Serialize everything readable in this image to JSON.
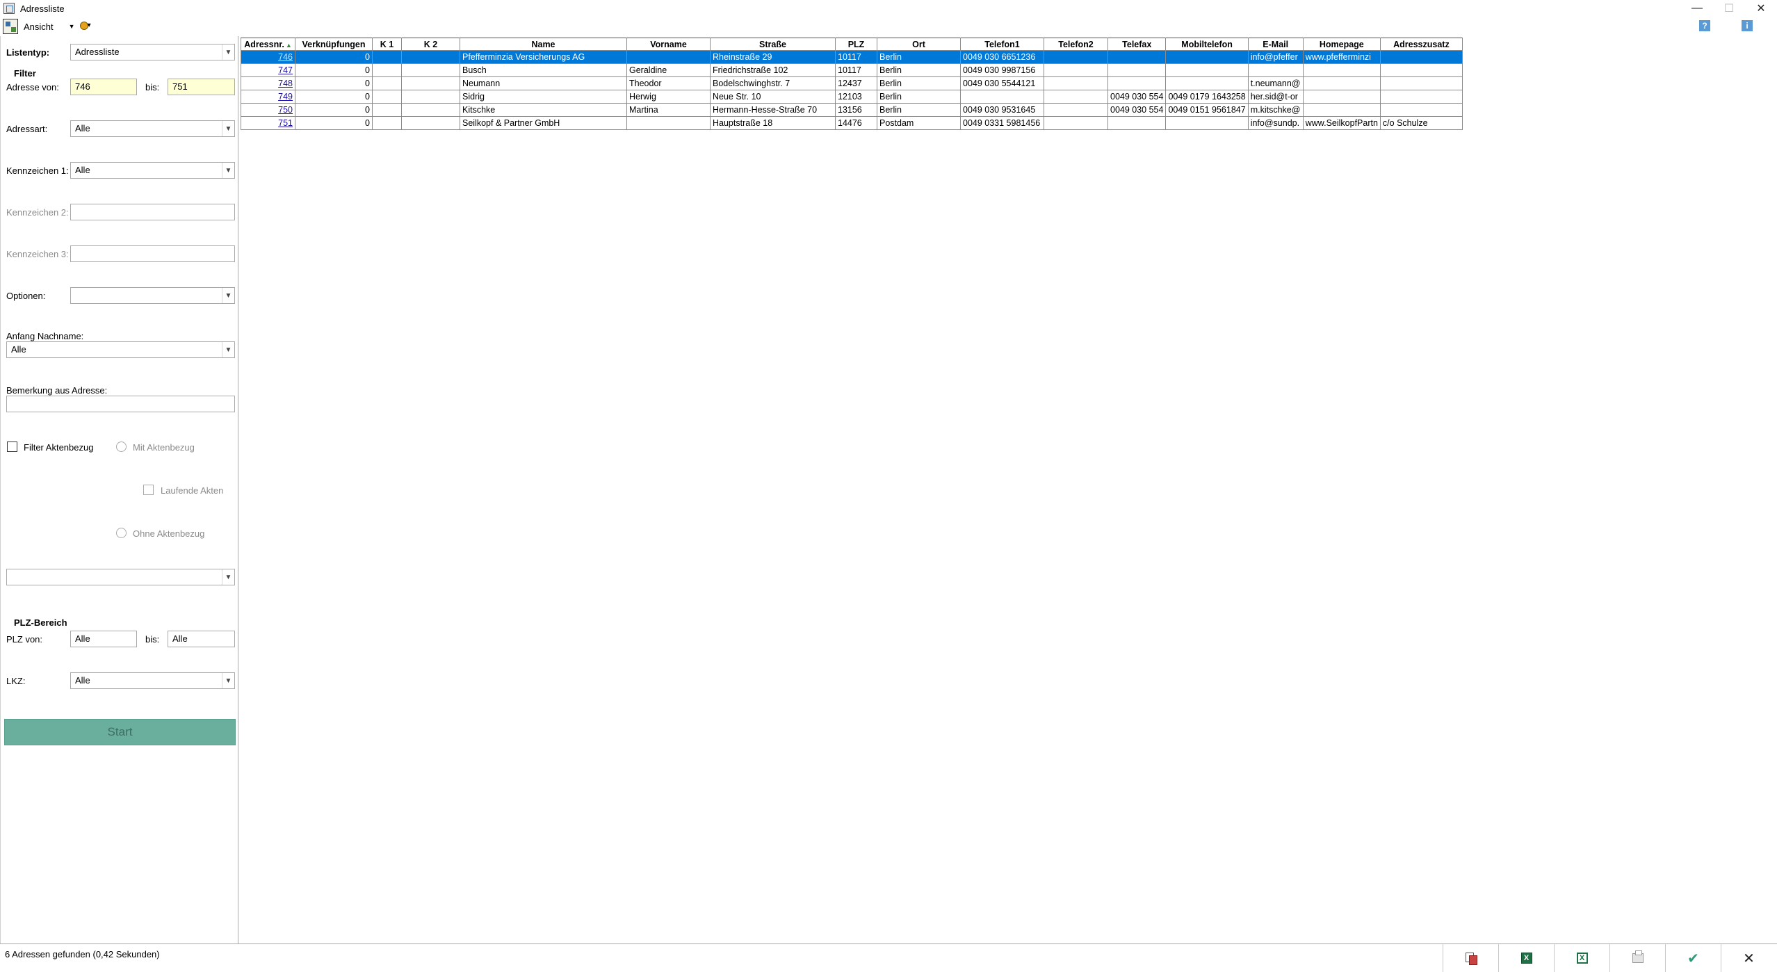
{
  "window": {
    "title": "Adressliste",
    "minimize": "—",
    "maximize": "☐",
    "close": "✕"
  },
  "menubar": {
    "view_label": "Ansicht",
    "help": "?",
    "info": "i"
  },
  "filters": {
    "listentyp_label": "Listentyp:",
    "listentyp_value": "Adressliste",
    "filter_heading": "Filter",
    "adresse_von_label": "Adresse von:",
    "adresse_von_value": "746",
    "bis_label": "bis:",
    "adresse_bis_value": "751",
    "adressart_label": "Adressart:",
    "adressart_value": "Alle",
    "kennzeichen1_label": "Kennzeichen 1:",
    "kennzeichen1_value": "Alle",
    "kennzeichen2_label": "Kennzeichen 2:",
    "kennzeichen2_value": "",
    "kennzeichen3_label": "Kennzeichen 3:",
    "kennzeichen3_value": "",
    "optionen_label": "Optionen:",
    "optionen_value": "",
    "anfang_nachname_label": "Anfang Nachname:",
    "anfang_nachname_value": "Alle",
    "bemerkung_label": "Bemerkung aus Adresse:",
    "bemerkung_value": "",
    "filter_aktenbezug_label": "Filter Aktenbezug",
    "mit_aktenbezug_label": "Mit Aktenbezug",
    "laufende_akten_label": "Laufende Akten",
    "ohne_aktenbezug_label": "Ohne Aktenbezug",
    "extra_combo_value": "",
    "plz_heading": "PLZ-Bereich",
    "plz_von_label": "PLZ von:",
    "plz_von_value": "Alle",
    "plz_bis_label": "bis:",
    "plz_bis_value": "Alle",
    "lkz_label": "LKZ:",
    "lkz_value": "Alle",
    "start_label": "Start"
  },
  "grid": {
    "columns": [
      "Adressnr.",
      "Verknüpfungen",
      "K 1",
      "K 2",
      "Name",
      "Vorname",
      "Straße",
      "PLZ",
      "Ort",
      "Telefon1",
      "Telefon2",
      "Telefax",
      "Mobiltelefon",
      "E-Mail",
      "Homepage",
      "Adresszusatz"
    ],
    "rows": [
      [
        "746",
        "0",
        "",
        "",
        "Pfefferminzia Versicherungs AG",
        "",
        "Rheinstraße 29",
        "10117",
        "Berlin",
        "0049 030 6651236",
        "",
        "",
        "",
        "info@pfeffer",
        "www.pfefferminzi",
        ""
      ],
      [
        "747",
        "0",
        "",
        "",
        "Busch",
        "Geraldine",
        "Friedrichstraße 102",
        "10117",
        "Berlin",
        "0049 030 9987156",
        "",
        "",
        "",
        "",
        "",
        ""
      ],
      [
        "748",
        "0",
        "",
        "",
        "Neumann",
        "Theodor",
        "Bodelschwinghstr. 7",
        "12437",
        "Berlin",
        "0049 030 5544121",
        "",
        "",
        "",
        "t.neumann@",
        "",
        ""
      ],
      [
        "749",
        "0",
        "",
        "",
        "Sidrig",
        "Herwig",
        "Neue Str. 10",
        "12103",
        "Berlin",
        "",
        "",
        "0049 030 554",
        "0049 0179 1643258",
        "her.sid@t-or",
        "",
        ""
      ],
      [
        "750",
        "0",
        "",
        "",
        "Kitschke",
        "Martina",
        "Hermann-Hesse-Straße 70",
        "13156",
        "Berlin",
        "0049 030 9531645",
        "",
        "0049 030 554",
        "0049 0151 9561847",
        "m.kitschke@",
        "",
        ""
      ],
      [
        "751",
        "0",
        "",
        "",
        "Seilkopf & Partner GmbH",
        "",
        "Hauptstraße 18",
        "14476",
        "Postdam",
        "0049 0331 5981456",
        "",
        "",
        "",
        "info@sundp.",
        "www.SeilkopfPartn",
        "c/o Schulze"
      ]
    ]
  },
  "status": {
    "text": "6 Adressen gefunden (0,42 Sekunden)"
  },
  "statusbar_buttons": {
    "excel1": "X",
    "excel2": "X",
    "check": "✔",
    "close": "✕"
  }
}
